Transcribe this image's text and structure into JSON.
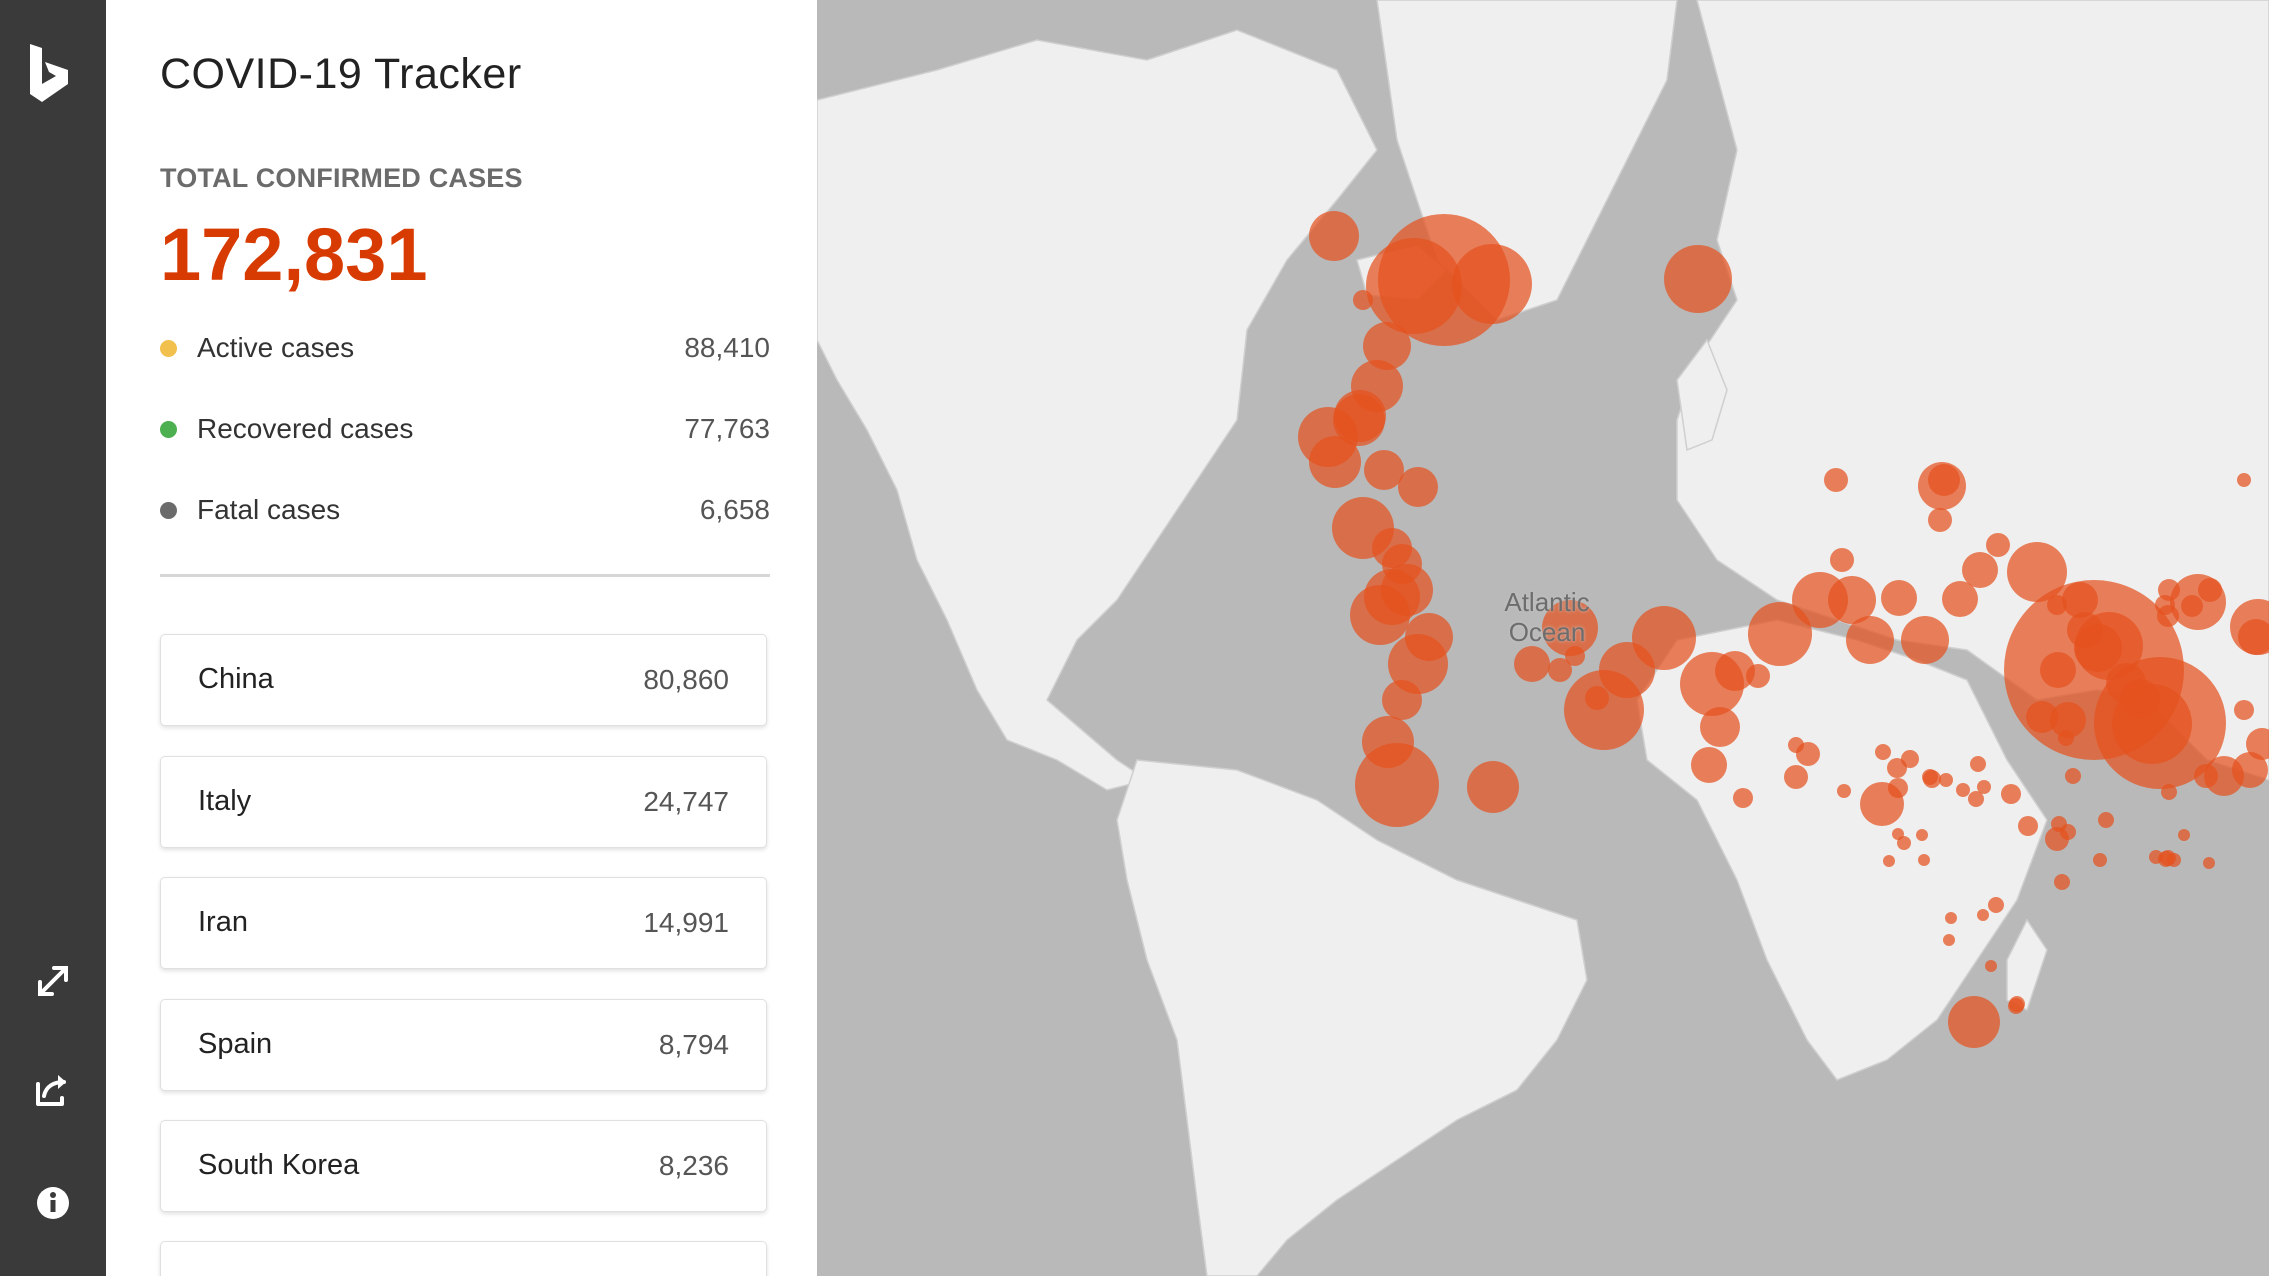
{
  "app": {
    "title": "COVID-19 Tracker"
  },
  "summary": {
    "total_label": "TOTAL CONFIRMED CASES",
    "total_value": "172,831",
    "stats": [
      {
        "label": "Active cases",
        "value": "88,410",
        "color": "#f2c04d"
      },
      {
        "label": "Recovered cases",
        "value": "77,763",
        "color": "#4caf50"
      },
      {
        "label": "Fatal cases",
        "value": "6,658",
        "color": "#6b6b6b"
      }
    ]
  },
  "countries": [
    {
      "name": "China",
      "count": "80,860"
    },
    {
      "name": "Italy",
      "count": "24,747"
    },
    {
      "name": "Iran",
      "count": "14,991"
    },
    {
      "name": "Spain",
      "count": "8,794"
    },
    {
      "name": "South Korea",
      "count": "8,236"
    },
    {
      "name": "",
      "count": ""
    }
  ],
  "rail": {
    "logo": "bing-logo",
    "buttons": [
      "expand-icon",
      "share-icon",
      "info-icon"
    ]
  },
  "map": {
    "ocean_label_line1": "Atlantic",
    "ocean_label_line2": "Ocean",
    "bubble_color": "#e4521f",
    "land_color": "#efefef",
    "water_color": "#b9b9b9"
  },
  "colors": {
    "accent": "#d83b01",
    "rail": "#3a3a3a"
  }
}
